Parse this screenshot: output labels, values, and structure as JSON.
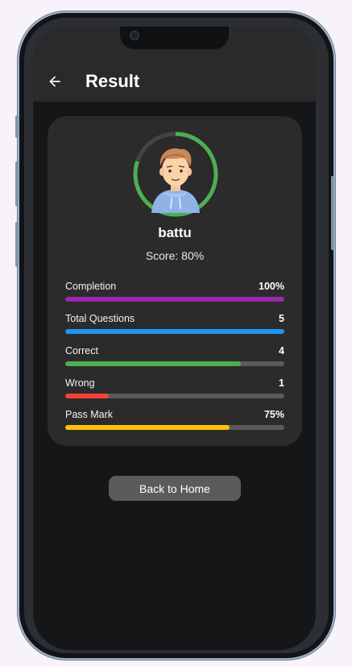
{
  "appbar": {
    "title": "Result",
    "back_icon": "arrow-left-icon"
  },
  "profile": {
    "name": "battu",
    "score_text": "Score: 80%",
    "score_fraction": 0.8,
    "avatar_icon": "user-avatar-icon"
  },
  "stats": [
    {
      "label": "Completion",
      "value": "100%",
      "fraction": 1.0,
      "color": "#9c27b0"
    },
    {
      "label": "Total Questions",
      "value": "5",
      "fraction": 1.0,
      "color": "#2196f3"
    },
    {
      "label": "Correct",
      "value": "4",
      "fraction": 0.8,
      "color": "#4caf50"
    },
    {
      "label": "Wrong",
      "value": "1",
      "fraction": 0.2,
      "color": "#f44336"
    },
    {
      "label": "Pass Mark",
      "value": "75%",
      "fraction": 0.75,
      "color": "#ffc107"
    }
  ],
  "home_button": {
    "label": "Back to Home"
  },
  "colors": {
    "ring": "#4caf50",
    "ring_track": "#444444",
    "card": "#2b2b2b",
    "appbar": "#2a2a2a"
  }
}
